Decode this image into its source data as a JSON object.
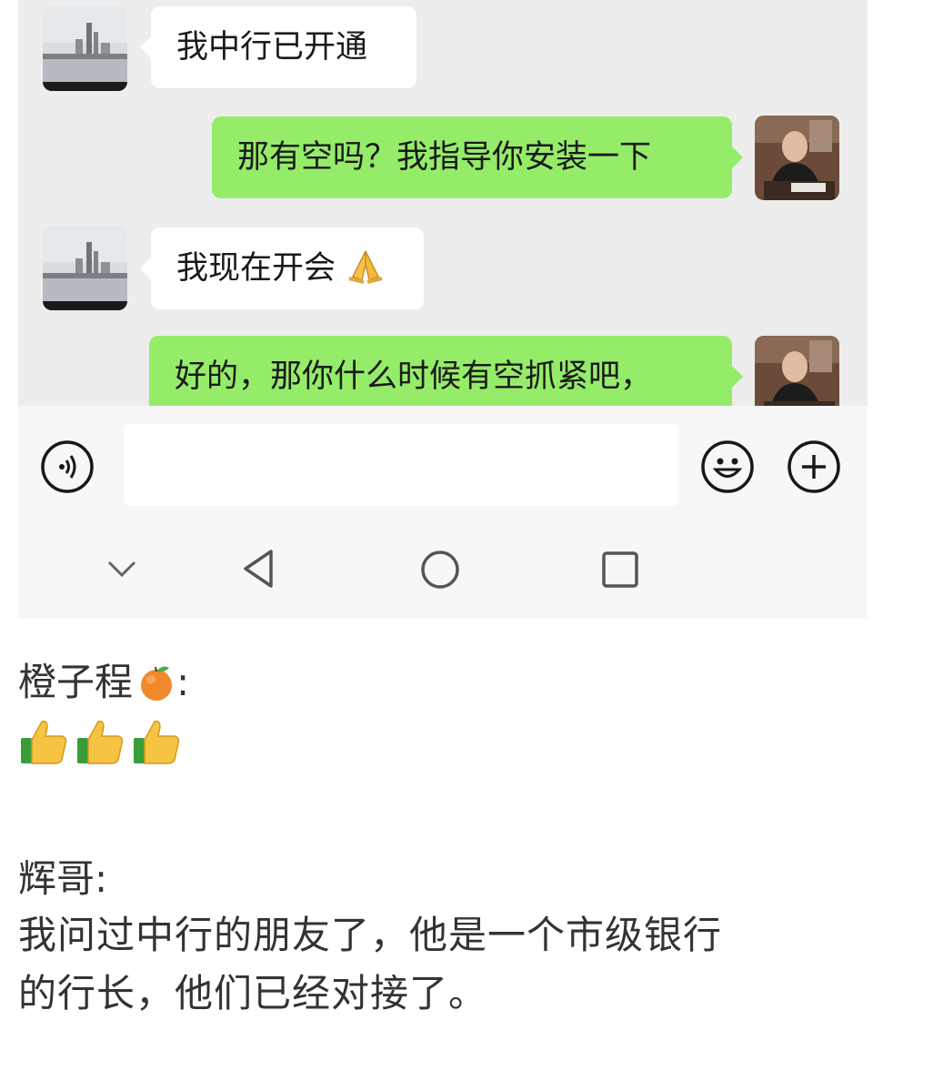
{
  "chat": {
    "messages": [
      {
        "side": "in",
        "text": "我中行已开通"
      },
      {
        "side": "out",
        "text": "那有空吗？我指导你安装一下"
      },
      {
        "side": "in",
        "text": "我现在开会",
        "emoji": "folded-hands-icon"
      },
      {
        "side": "out",
        "text": "好的，那你什么时候有空抓紧吧，"
      }
    ]
  },
  "input_bar": {
    "voice_icon": "voice-icon",
    "emoji_icon": "smiley-icon",
    "plus_icon": "plus-icon",
    "text_value": ""
  },
  "nav_bar": {
    "icons": [
      "chevron-down-icon",
      "back-triangle-icon",
      "home-circle-icon",
      "recents-square-icon"
    ]
  },
  "comments": [
    {
      "author": "橙子程",
      "author_emoji": "tangerine-icon",
      "colon": ":",
      "content_emojis": [
        "thumbs-up-icon",
        "thumbs-up-icon",
        "thumbs-up-icon"
      ]
    },
    {
      "author": "辉哥",
      "colon": ":",
      "text_line1": "我问过中行的朋友了，他是一个市级银行",
      "text_line2": "的行长，他们已经对接了。"
    }
  ],
  "colors": {
    "chat_bg": "#ededed",
    "out_bubble": "#95ec69",
    "in_bubble": "#ffffff"
  }
}
